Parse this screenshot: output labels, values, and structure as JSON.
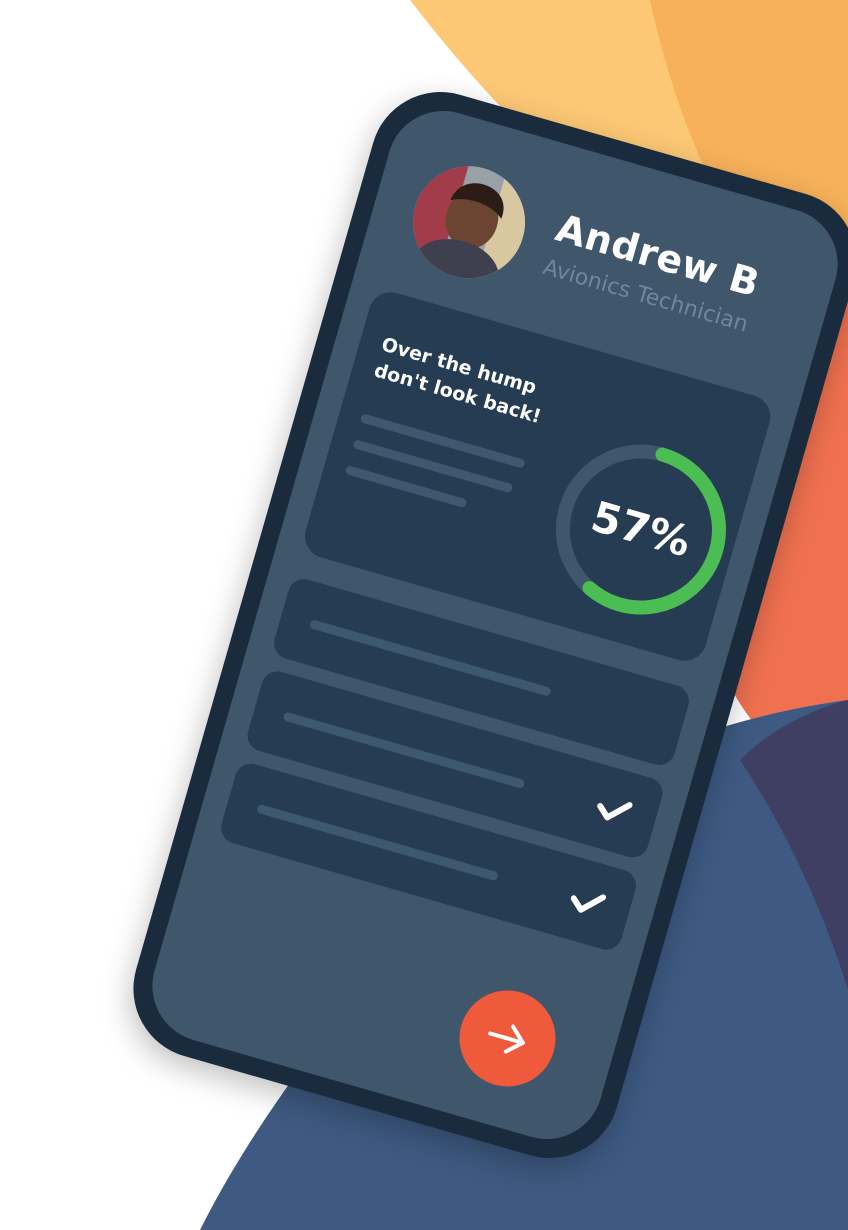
{
  "profile": {
    "name": "Andrew B",
    "role": "Avionics Technician"
  },
  "progress_card": {
    "motivation_line1": "Over the hump",
    "motivation_line2": "don't look back!",
    "percent": 57,
    "percent_label": "57%"
  },
  "tasks": [
    {
      "completed": false,
      "icon": null
    },
    {
      "completed": true,
      "icon": "check-icon"
    },
    {
      "completed": true,
      "icon": "check-icon"
    },
    {
      "completed": true,
      "icon": "check-icon"
    }
  ],
  "next_button": {
    "icon": "arrow-right-icon"
  },
  "colors": {
    "phone_frame": "#1a2b3e",
    "screen_bg": "#3f566b",
    "card_bg": "#263c52",
    "ring_track": "#3f566b",
    "ring_progress": "#4cbd52",
    "accent_button": "#ef5a3c",
    "bg_yellow": "#fcc876",
    "bg_orange": "#f7b15a",
    "bg_coral": "#f07150",
    "bg_navy": "#3e5a82",
    "bg_dark_navy": "#3e3f62"
  }
}
